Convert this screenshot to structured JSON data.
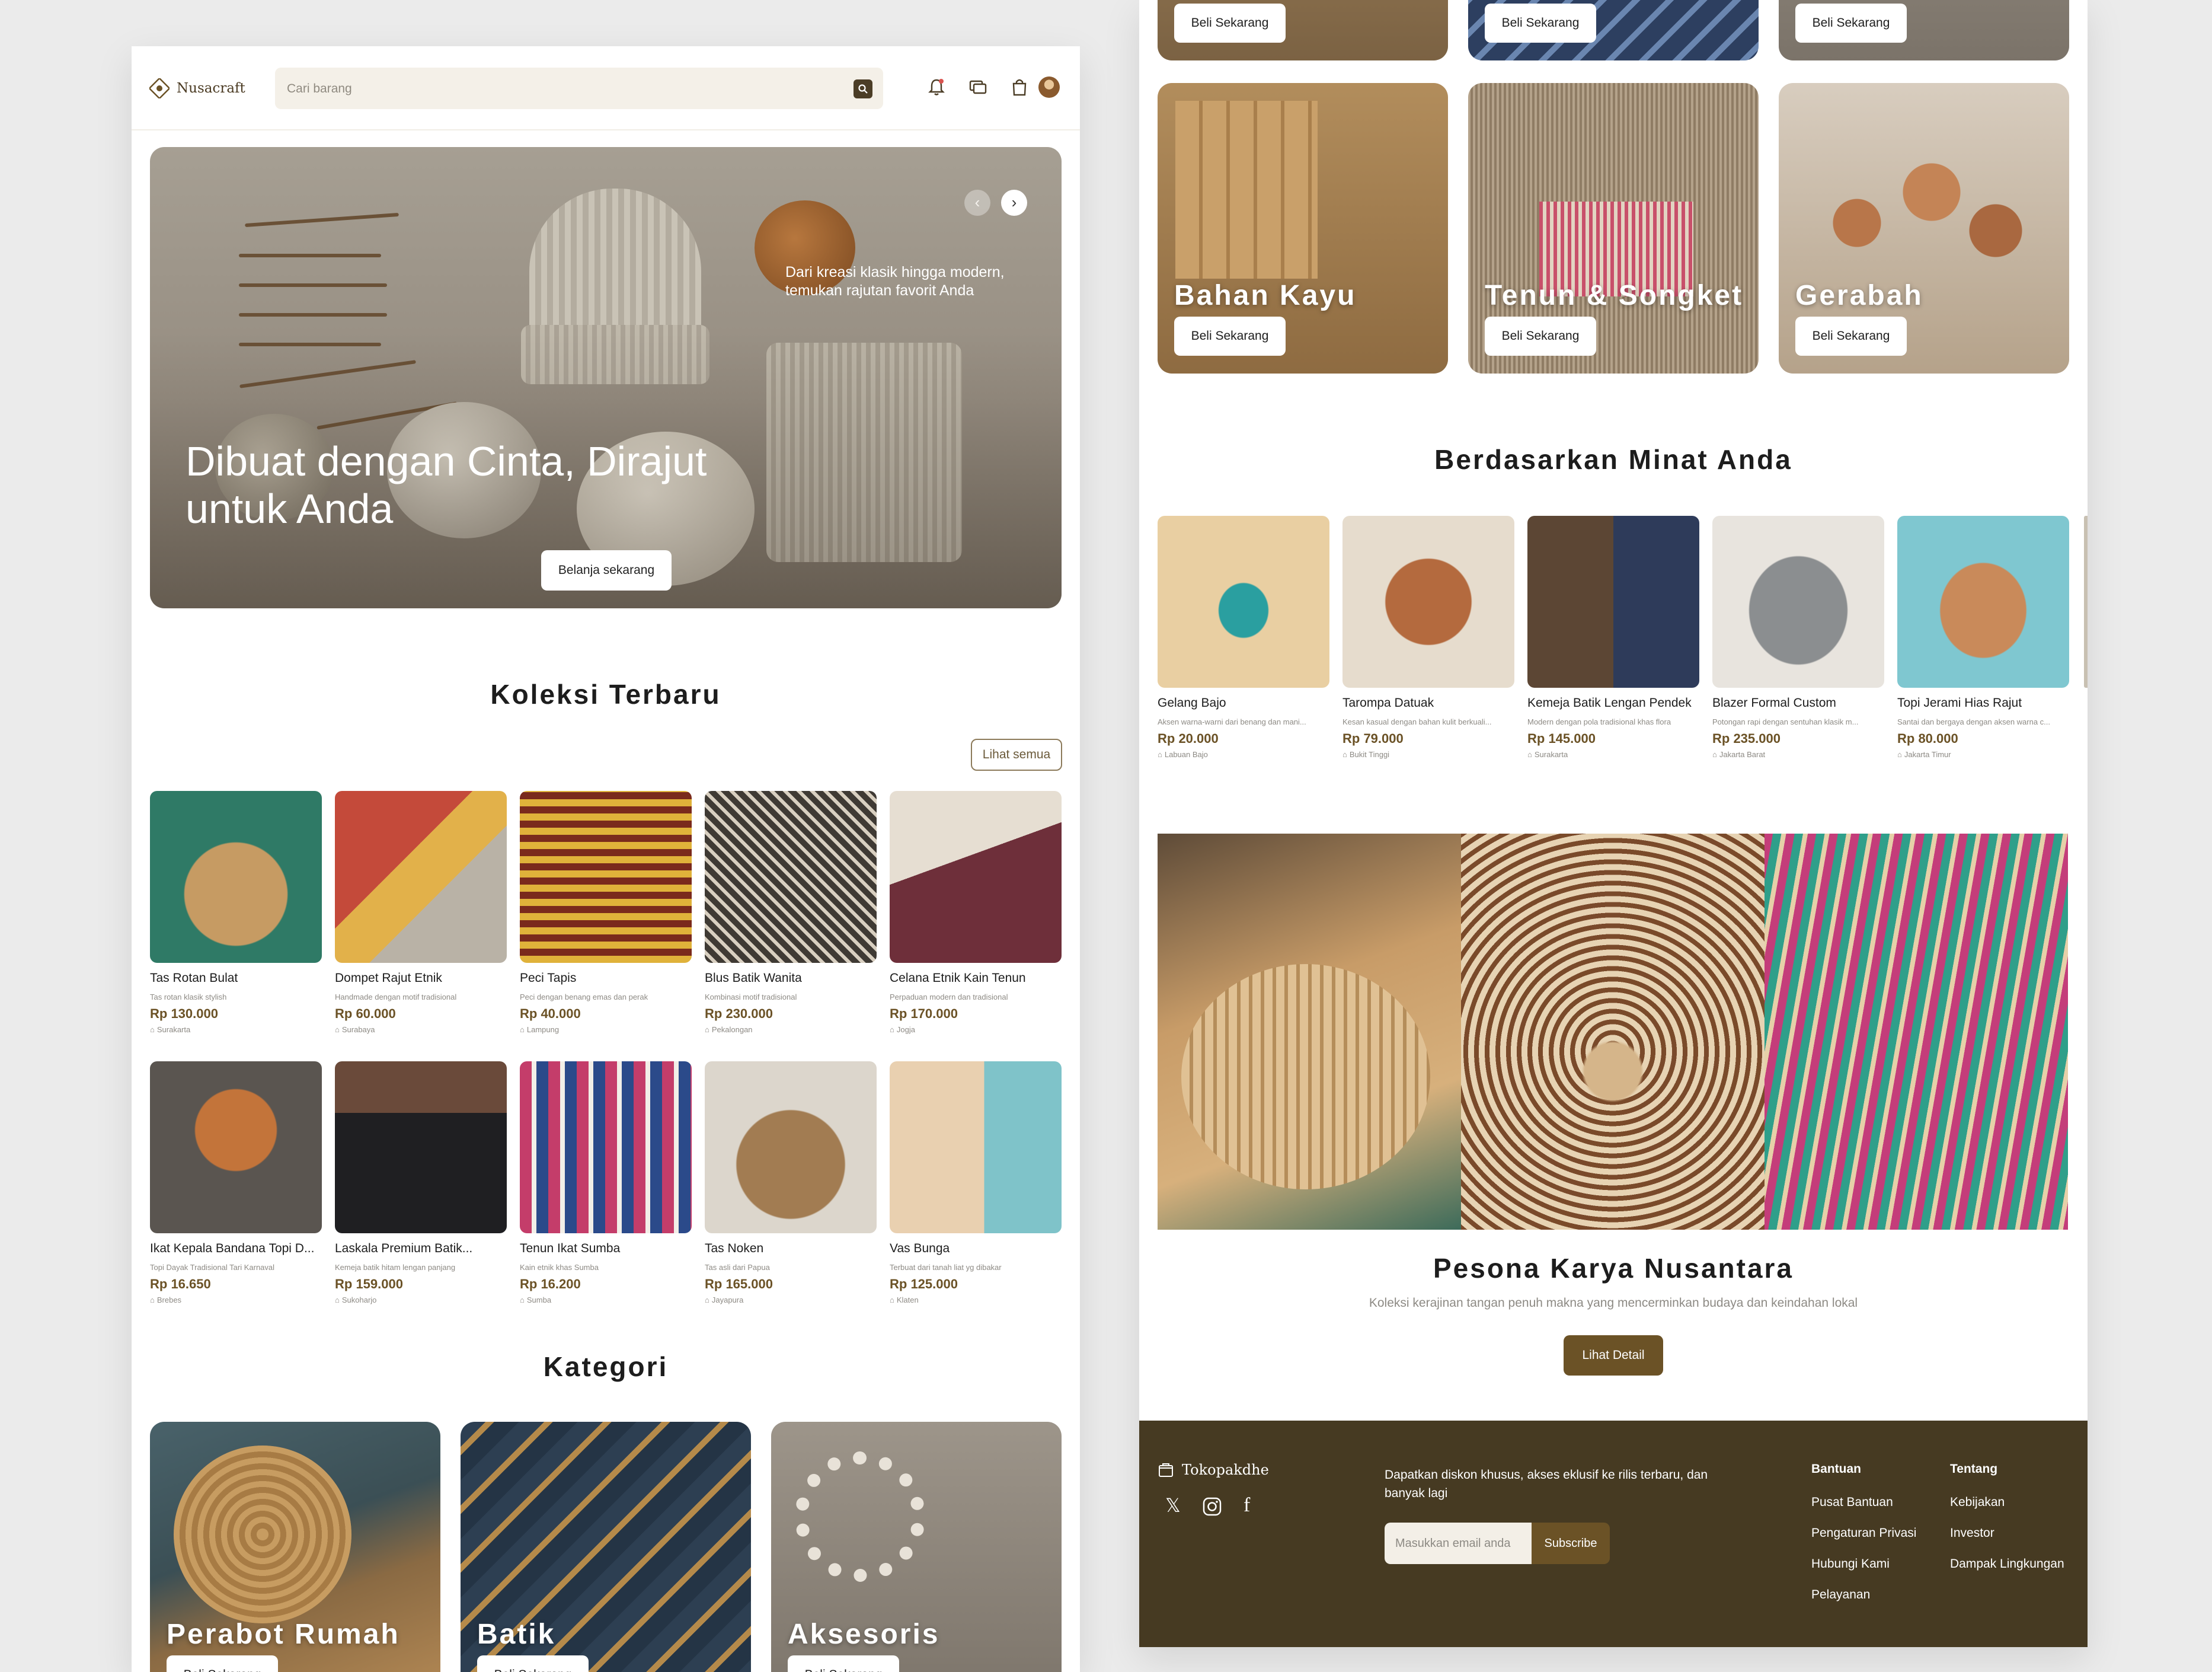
{
  "header": {
    "brand": "Nusacraft",
    "search_placeholder": "Cari barang",
    "icons": [
      "bell-icon",
      "chat-icon",
      "bag-icon",
      "avatar"
    ]
  },
  "hero": {
    "subtitle": "Dari kreasi klasik hingga modern, temukan rajutan favorit Anda",
    "title": "Dibuat dengan Cinta, Dirajut untuk Anda",
    "cta": "Belanja sekarang"
  },
  "latest": {
    "title": "Koleksi Terbaru",
    "see_all": "Lihat semua",
    "products": [
      {
        "name": "Tas Rotan Bulat",
        "desc": "Tas rotan klasik stylish",
        "price": "Rp 130.000",
        "loc": "Surakarta"
      },
      {
        "name": "Dompet Rajut Etnik",
        "desc": "Handmade dengan motif tradisional",
        "price": "Rp 60.000",
        "loc": "Surabaya"
      },
      {
        "name": "Peci Tapis",
        "desc": "Peci dengan benang emas dan perak",
        "price": "Rp 40.000",
        "loc": "Lampung"
      },
      {
        "name": "Blus Batik Wanita",
        "desc": "Kombinasi motif tradisional",
        "price": "Rp 230.000",
        "loc": "Pekalongan"
      },
      {
        "name": "Celana Etnik Kain Tenun",
        "desc": "Perpaduan modern dan tradisional",
        "price": "Rp 170.000",
        "loc": "Jogja"
      },
      {
        "name": "Ikat Kepala Bandana Topi D...",
        "desc": "Topi Dayak Tradisional Tari Karnaval",
        "price": "Rp 16.650",
        "loc": "Brebes"
      },
      {
        "name": "Laskala Premium Batik...",
        "desc": "Kemeja batik hitam lengan panjang",
        "price": "Rp 159.000",
        "loc": "Sukoharjo"
      },
      {
        "name": "Tenun Ikat Sumba",
        "desc": "Kain etnik khas Sumba",
        "price": "Rp 16.200",
        "loc": "Sumba"
      },
      {
        "name": "Tas Noken",
        "desc": "Tas asli dari Papua",
        "price": "Rp 165.000",
        "loc": "Jayapura"
      },
      {
        "name": "Vas Bunga",
        "desc": "Terbuat dari tanah liat yg dibakar",
        "price": "Rp 125.000",
        "loc": "Klaten"
      }
    ]
  },
  "categories": {
    "title": "Kategori",
    "buy_label": "Beli Sekarang",
    "items_left": [
      "Perabot Rumah",
      "Batik",
      "Aksesoris"
    ],
    "items_right": [
      "Bahan Kayu",
      "Tenun & Songket",
      "Gerabah"
    ]
  },
  "interest": {
    "title": "Berdasarkan Minat Anda",
    "products": [
      {
        "name": "Gelang Bajo",
        "desc": "Aksen warna-warni dari benang dan mani...",
        "price": "Rp 20.000",
        "loc": "Labuan Bajo"
      },
      {
        "name": "Tarompa Datuak",
        "desc": "Kesan kasual dengan bahan kulit berkuali...",
        "price": "Rp 79.000",
        "loc": "Bukit Tinggi"
      },
      {
        "name": "Kemeja Batik Lengan Pendek",
        "desc": "Modern dengan pola tradisional khas flora",
        "price": "Rp 145.000",
        "loc": "Surakarta"
      },
      {
        "name": "Blazer Formal Custom",
        "desc": "Potongan rapi dengan sentuhan klasik m...",
        "price": "Rp 235.000",
        "loc": "Jakarta Barat"
      },
      {
        "name": "Topi Jerami Hias Rajut",
        "desc": "Santai dan bergaya dengan aksen warna c...",
        "price": "Rp 80.000",
        "loc": "Jakarta Timur"
      }
    ]
  },
  "pesona": {
    "title": "Pesona Karya Nusantara",
    "subtitle": "Koleksi kerajinan tangan penuh makna yang mencerminkan budaya dan keindahan lokal",
    "cta": "Lihat Detail"
  },
  "footer": {
    "brand": "Tokopakdhe",
    "promo": "Dapatkan diskon khusus, akses eklusif ke rilis terbaru, dan banyak lagi",
    "email_placeholder": "Masukkan email anda",
    "subscribe": "Subscribe",
    "col1_title": "Bantuan",
    "col1_links": [
      "Pusat Bantuan",
      "Pengaturan Privasi",
      "Hubungi Kami",
      "Pelayanan"
    ],
    "col2_title": "Tentang",
    "col2_links": [
      "Kebijakan",
      "Investor",
      "Dampak Lingkungan"
    ]
  },
  "colors": {
    "brand_brown": "#463a22",
    "accent_brown": "#6b5226",
    "search_bg": "#f4f0e8"
  }
}
